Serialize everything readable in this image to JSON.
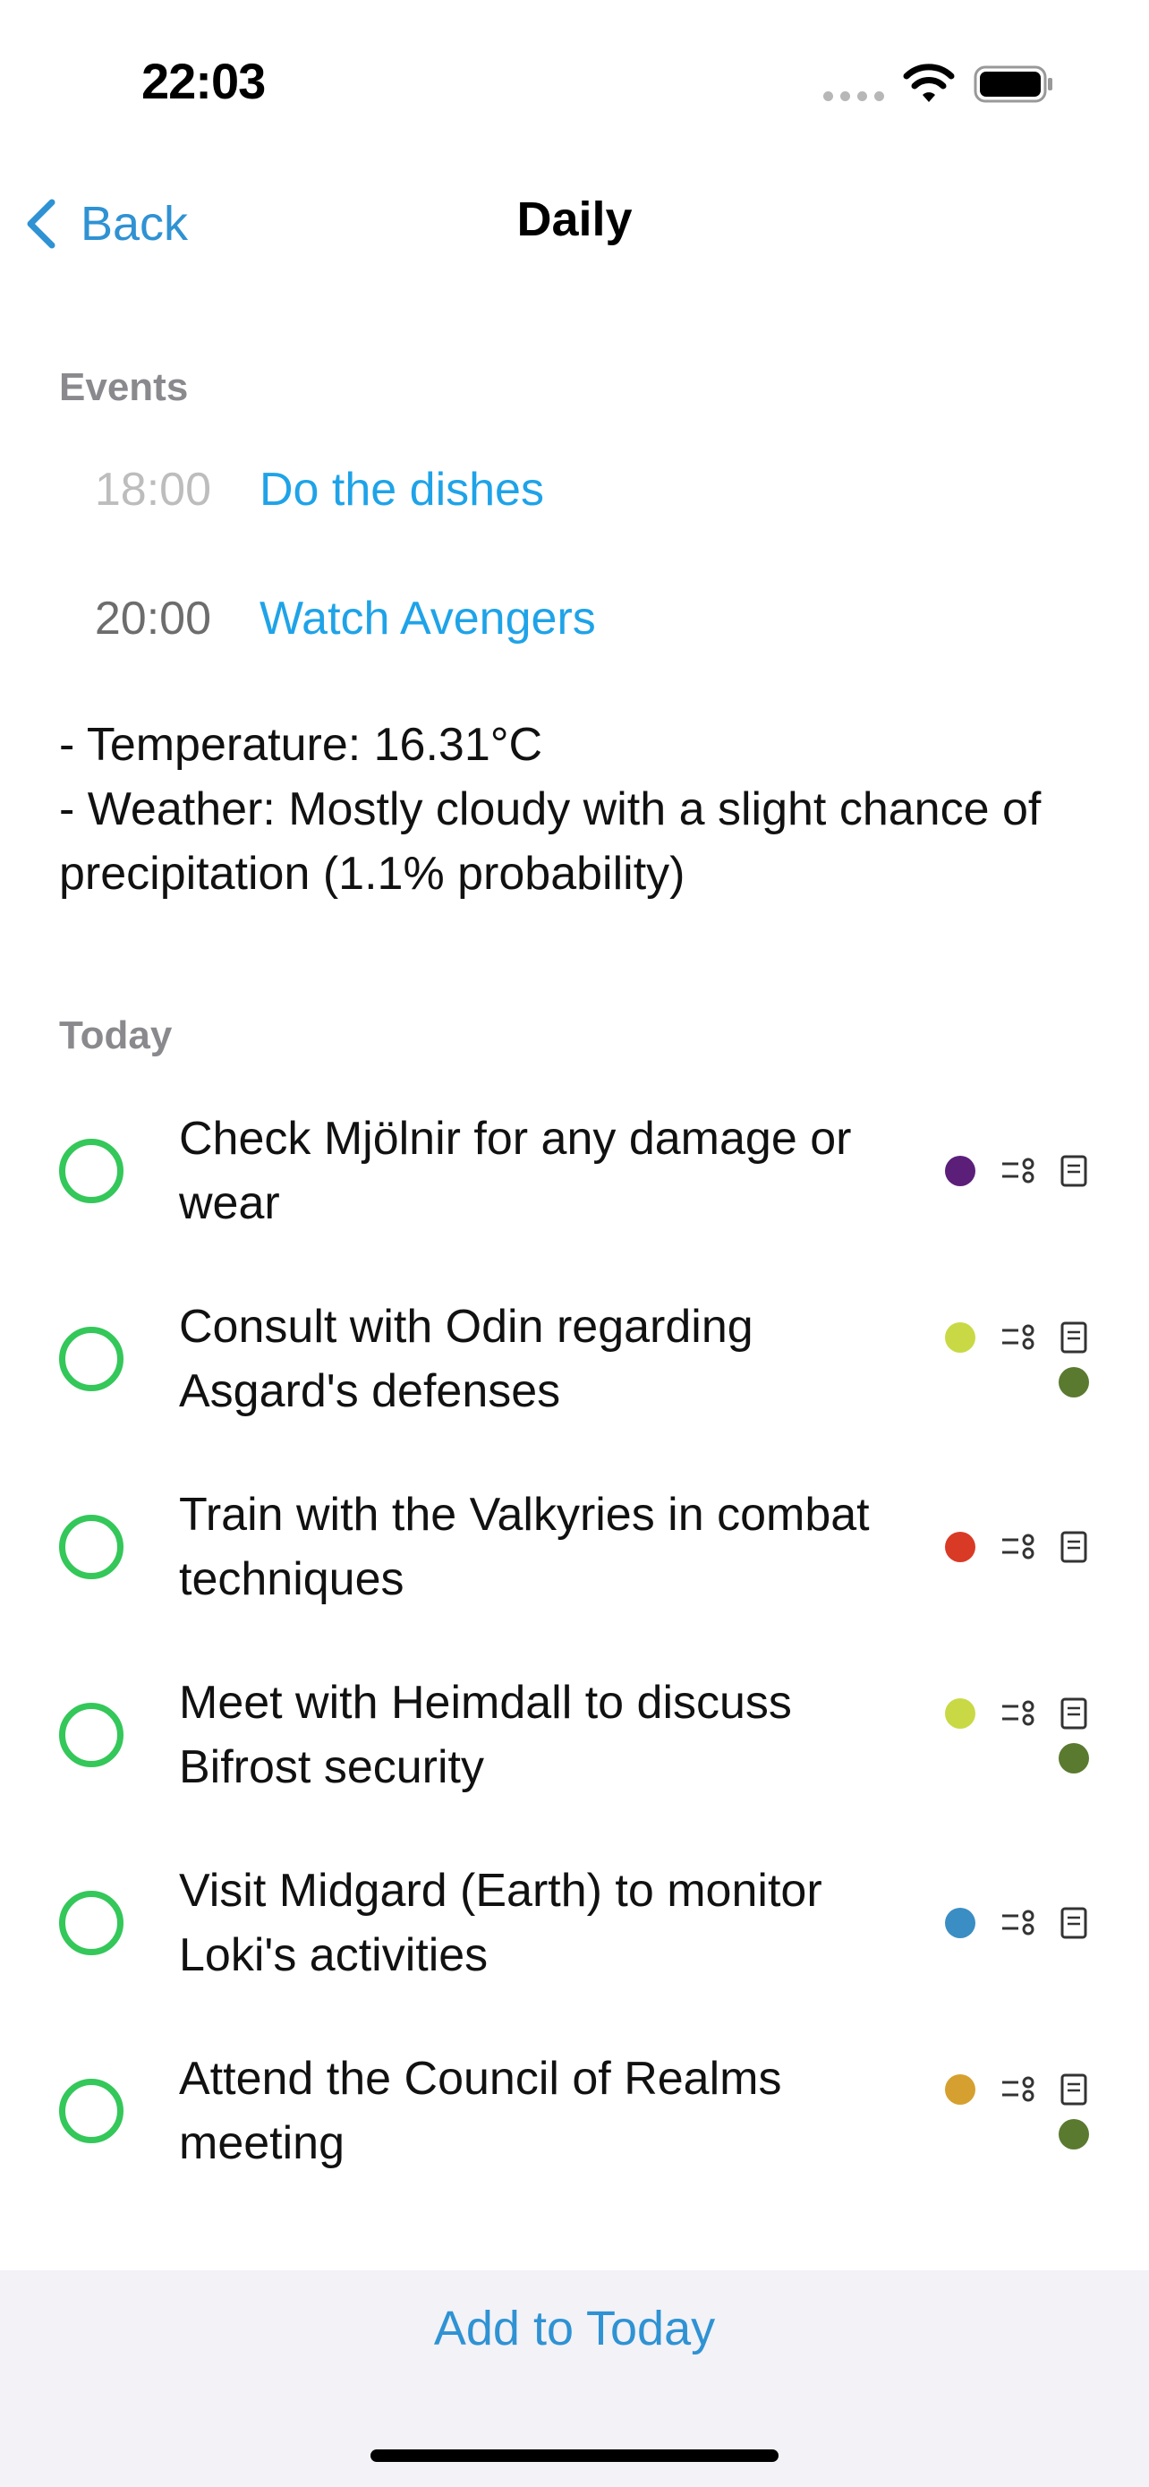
{
  "status_bar": {
    "time": "22:03",
    "icons": [
      "cellular-signal-icon",
      "wifi-icon",
      "battery-icon"
    ]
  },
  "nav": {
    "back_label": "Back",
    "back_icon": "chevron-left-icon",
    "title": "Daily"
  },
  "events": {
    "header": "Events",
    "items": [
      {
        "time": "18:00",
        "title": "Do the dishes",
        "time_color": "#bdbdbd"
      },
      {
        "time": "20:00",
        "title": "Watch Avengers",
        "time_color": "#6d6d6d"
      }
    ]
  },
  "weather": {
    "temperature_line": "- Temperature: 16.31°C",
    "weather_line": "- Weather: Mostly cloudy with a slight chance of precipitation (1.1% probability)"
  },
  "today": {
    "header": "Today",
    "tasks": [
      {
        "title": "Check Mjölnir for any damage or wear",
        "tag_color": "#5b1f7a",
        "extra_dot": false
      },
      {
        "title": "Consult with Odin regarding Asgard's defenses",
        "tag_color": "#c9d945",
        "extra_dot": true,
        "extra_dot_color": "#5a7a30"
      },
      {
        "title": "Train with the Valkyries in combat techniques",
        "tag_color": "#d93a26",
        "extra_dot": false
      },
      {
        "title": "Meet with Heimdall to discuss Bifrost security",
        "tag_color": "#c9d945",
        "extra_dot": true,
        "extra_dot_color": "#5a7a30"
      },
      {
        "title": "Visit Midgard (Earth) to monitor Loki's activities",
        "tag_color": "#3a8ec4",
        "extra_dot": false
      },
      {
        "title": "Attend the Council of Realms meeting",
        "tag_color": "#d6a030",
        "extra_dot": true,
        "extra_dot_color": "#5a7a30"
      }
    ]
  },
  "bottom": {
    "add_label": "Add to Today"
  },
  "colors": {
    "accent": "#2f92d3",
    "event_link": "#1fa3e8",
    "check_green": "#34c759",
    "section_gray": "#8a8a8e",
    "bottom_bg": "#f2f2f7"
  }
}
